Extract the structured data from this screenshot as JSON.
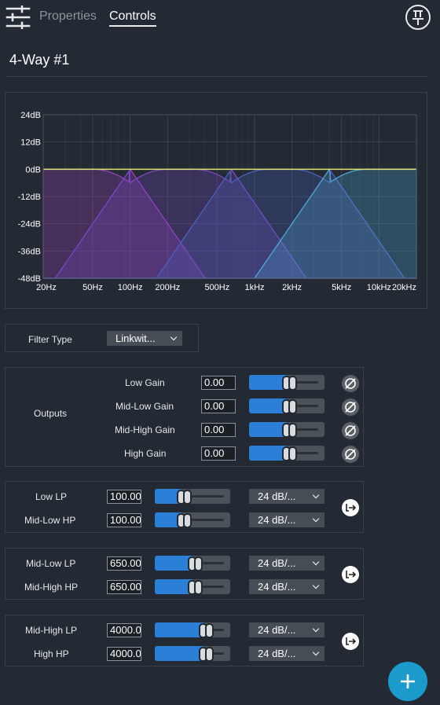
{
  "header": {
    "tabs": [
      {
        "label": "Properties",
        "active": false
      },
      {
        "label": "Controls",
        "active": true
      }
    ],
    "icons": {
      "menu": "sliders-icon",
      "pin": "pin-icon"
    }
  },
  "title": "4-Way #1",
  "chart_data": {
    "type": "area",
    "x_scale": "log",
    "x_tick_labels": [
      "20Hz",
      "50Hz",
      "100Hz",
      "200Hz",
      "500Hz",
      "1kHz",
      "2kHz",
      "5kHz",
      "10kHz",
      "20kHz"
    ],
    "y_tick_labels": [
      "24dB",
      "12dB",
      "0dB",
      "-12dB",
      "-24dB",
      "-36dB",
      "-48dB"
    ],
    "ylim": [
      -48,
      24
    ],
    "grid": true,
    "series": [
      {
        "color": "#9b3fbf",
        "crossovers": [
          null,
          100
        ]
      },
      {
        "color": "#7a48c4",
        "crossovers": [
          100,
          650
        ]
      },
      {
        "color": "#4c5fbe",
        "crossovers": [
          650,
          4000
        ]
      },
      {
        "color": "#4fa9d8",
        "crossovers": [
          4000,
          null
        ]
      }
    ],
    "sum_line_color": "#e3e07a"
  },
  "filter": {
    "label": "Filter Type",
    "value": "Linkwit..."
  },
  "outputs": {
    "label": "Outputs",
    "rows": [
      {
        "label": "Low Gain",
        "value": "0.00",
        "level": 0.5
      },
      {
        "label": "Mid-Low Gain",
        "value": "0.00",
        "level": 0.5
      },
      {
        "label": "Mid-High Gain",
        "value": "0.00",
        "level": 0.5
      },
      {
        "label": "High Gain",
        "value": "0.00",
        "level": 0.5
      }
    ]
  },
  "crossovers": [
    {
      "rows": [
        {
          "label": "Low LP",
          "value": "100.00",
          "slope": "24 dB/...",
          "level": 0.3
        },
        {
          "label": "Mid-Low HP",
          "value": "100.00",
          "slope": "24 dB/...",
          "level": 0.3
        }
      ]
    },
    {
      "rows": [
        {
          "label": "Mid-Low LP",
          "value": "650.00",
          "slope": "24 dB/...",
          "level": 0.5
        },
        {
          "label": "Mid-High HP",
          "value": "650.00",
          "slope": "24 dB/...",
          "level": 0.5
        }
      ]
    },
    {
      "rows": [
        {
          "label": "Mid-High LP",
          "value": "4000.0",
          "slope": "24 dB/...",
          "level": 0.7
        },
        {
          "label": "High HP",
          "value": "4000.0",
          "slope": "24 dB/...",
          "level": 0.7
        }
      ]
    }
  ],
  "link_label": "L",
  "fab_icon": "plus-icon"
}
